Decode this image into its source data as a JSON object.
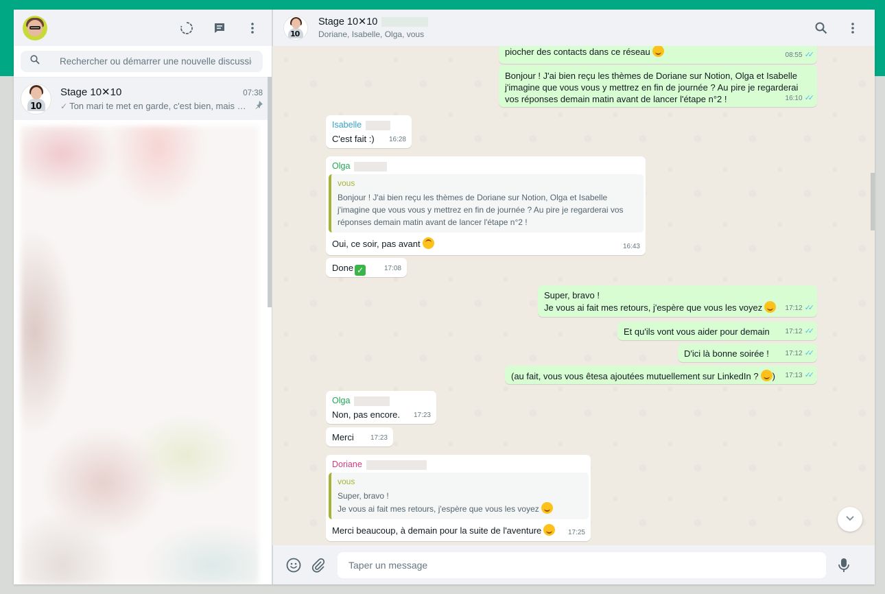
{
  "sidebar": {
    "search_placeholder": "Rechercher ou démarrer une nouvelle discussion",
    "chats": [
      {
        "name": "Stage 10✕10",
        "time": "07:38",
        "last_message": "Ton mari te met en garde, c'est bien, mais c'..."
      }
    ]
  },
  "conversation": {
    "title": "Stage 10✕10",
    "subtitle": "Doriane, Isabelle, Olga, vous",
    "input_placeholder": "Taper un message",
    "messages": [
      {
        "dir": "out",
        "text": "piocher des contacts dans ce réseau",
        "time": "08:55"
      },
      {
        "dir": "out",
        "text": "Bonjour ! J'ai bien reçu les thèmes de Doriane sur Notion, Olga et Isabelle j'imagine que vous vous y mettrez en fin de journée ? Au pire je regarderai vos réponses demain matin avant de lancer l'étape n°2 !",
        "time": "16:10"
      },
      {
        "dir": "in",
        "sender": "Isabelle",
        "text": "C'est fait :)",
        "time": "16:28"
      },
      {
        "dir": "in",
        "sender": "Olga",
        "quote_author": "vous",
        "quote_text": "Bonjour ! J'ai bien reçu les thèmes de Doriane sur Notion, Olga et Isabelle j'imagine que vous vous y mettrez en fin de journée ? Au pire je regarderai vos réponses demain matin avant de lancer l'étape n°2 !",
        "text": "Oui, ce soir, pas avant",
        "time": "16:43"
      },
      {
        "dir": "in",
        "text": "Done",
        "time": "17:08"
      },
      {
        "dir": "out",
        "line1": "Super, bravo !",
        "line2": "Je vous ai fait mes retours, j'espère que vous les voyez",
        "time": "17:12"
      },
      {
        "dir": "out",
        "text": "Et qu'ils vont vous aider pour demain",
        "time": "17:12"
      },
      {
        "dir": "out",
        "text": "D'ici là bonne soirée !",
        "time": "17:12"
      },
      {
        "dir": "out",
        "text_before": "(au fait, vous vous êtesa ajoutées mutuellement sur LinkedIn ?",
        "text_after": ")",
        "time": "17:13"
      },
      {
        "dir": "in",
        "sender": "Olga",
        "text": "Non, pas encore.",
        "time": "17:23"
      },
      {
        "dir": "in",
        "text": "Merci",
        "time": "17:23"
      },
      {
        "dir": "in",
        "sender": "Doriane",
        "quote_author": "vous",
        "quote_line1": "Super, bravo !",
        "quote_line2": "Je vous ai fait mes retours, j'espère que vous les voyez",
        "text": "Merci beaucoup, à demain pour la suite de l'aventure",
        "time": "17:25"
      }
    ]
  },
  "colors": {
    "accent": "#00a884",
    "outgoing_bubble": "#d9fdd3",
    "incoming_bubble": "#ffffff",
    "isabelle_name": "#35a3c5",
    "olga_name": "#1fa855",
    "doriane_name": "#d3397e",
    "read_tick": "#53bdeb"
  },
  "icons": [
    "status-icon",
    "new-chat-icon",
    "menu-icon",
    "search-icon",
    "pin-icon",
    "emoji-icon",
    "attach-icon",
    "mic-icon",
    "chevron-down-icon"
  ]
}
